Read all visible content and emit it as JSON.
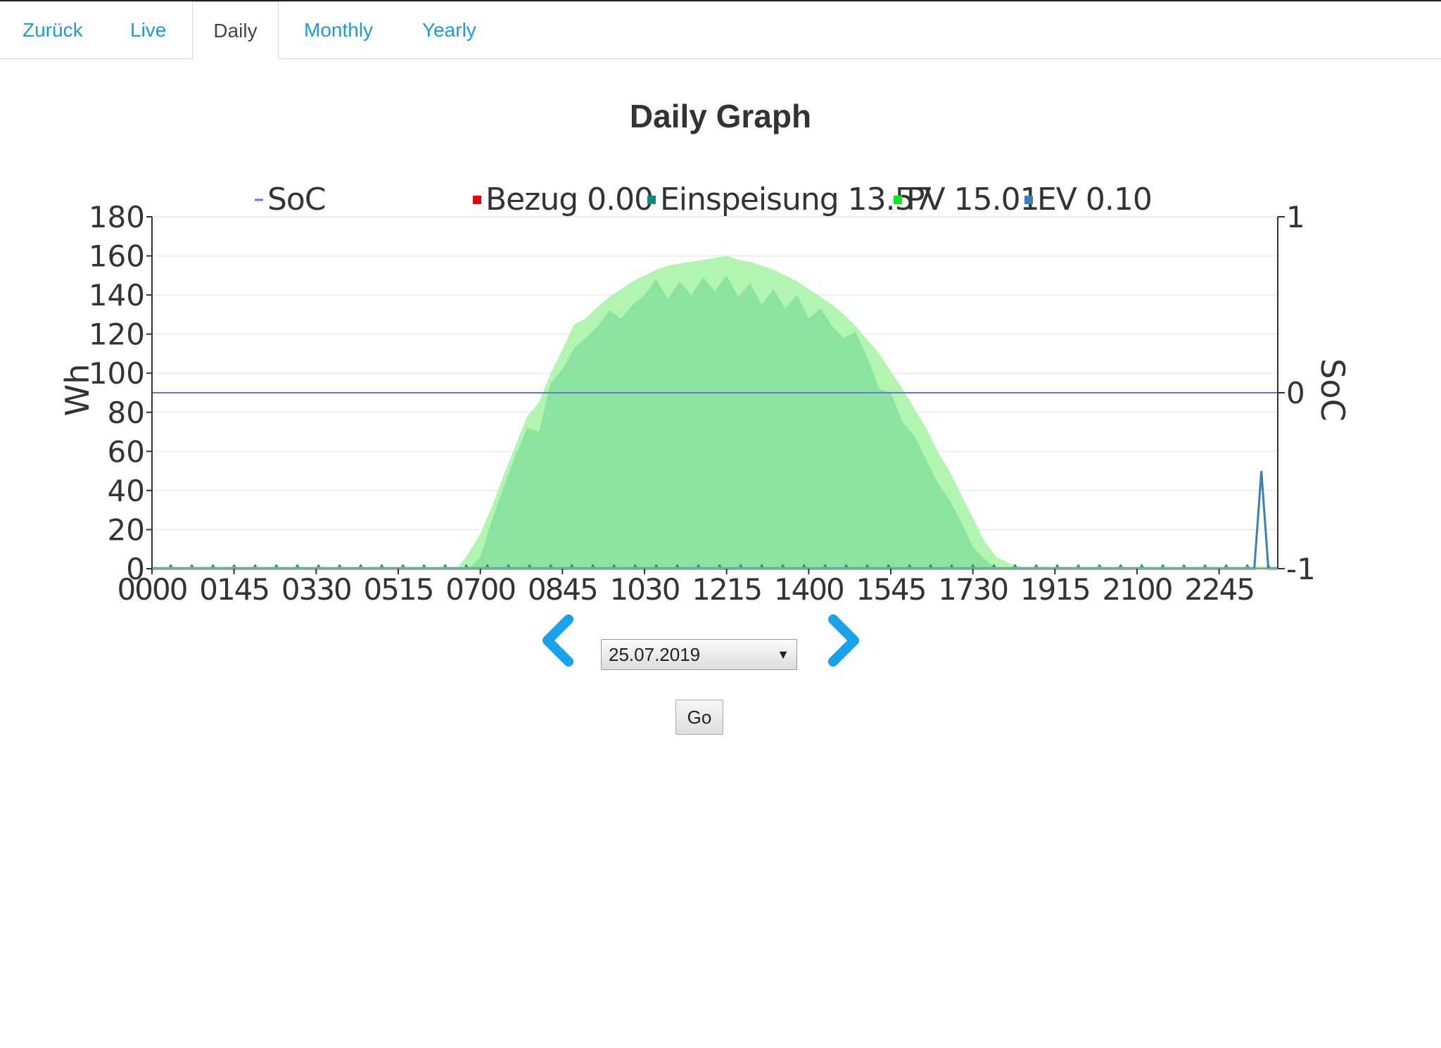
{
  "tabs": [
    {
      "label": "Zurück",
      "active": false
    },
    {
      "label": "Live",
      "active": false
    },
    {
      "label": "Daily",
      "active": true
    },
    {
      "label": "Monthly",
      "active": false
    },
    {
      "label": "Yearly",
      "active": false
    }
  ],
  "page_title": "Daily Graph",
  "date_select": {
    "value": "25.07.2019"
  },
  "go_button": {
    "label": "Go"
  },
  "colors": {
    "link": "#1f9ad6",
    "pv_fill": "#b2f5b0",
    "einspeisung_fill": "#8be3a0",
    "soc_line": "#6f72e6",
    "ev_line": "#3c7fb4",
    "bezug": "#e8000b",
    "einspeisung_marker": "#108a7e",
    "pv_marker": "#11e81a",
    "ev_marker": "#3b7db9",
    "arrow": "#1aa1ec"
  },
  "icons": {
    "prev": "chevron-left-icon",
    "next": "chevron-right-icon",
    "select_caret": "triangle-down-icon"
  },
  "chart_data": {
    "type": "area",
    "xlabel": "",
    "ylabel": "Wh",
    "y2label": "SoC",
    "ylim": [
      0,
      180
    ],
    "y2lim": [
      -1,
      1
    ],
    "yticks": [
      "0",
      "20",
      "40",
      "60",
      "80",
      "100",
      "120",
      "140",
      "160",
      "180"
    ],
    "y2ticks": [
      "-1",
      "0",
      "1"
    ],
    "xticks": [
      "0000",
      "0145",
      "0330",
      "0515",
      "0700",
      "0845",
      "1030",
      "1215",
      "1400",
      "1545",
      "1730",
      "1915",
      "2100",
      "2245"
    ],
    "xrange_hours": [
      0,
      24
    ],
    "grid": true,
    "legend_position": "top",
    "legend": [
      {
        "name": "SoC",
        "value": "",
        "marker": "line"
      },
      {
        "name": "Bezug",
        "value": "0.00",
        "marker": "square"
      },
      {
        "name": "Einspeisung",
        "value": "13.57",
        "marker": "square"
      },
      {
        "name": "PV",
        "value": "15.01",
        "marker": "square"
      },
      {
        "name": "EV",
        "value": "0.10",
        "marker": "square"
      }
    ],
    "series": [
      {
        "name": "PV",
        "axis": "left",
        "x_hours": [
          0,
          6.5,
          6.75,
          7.0,
          7.25,
          7.5,
          7.75,
          8.0,
          8.25,
          8.5,
          8.75,
          9.0,
          9.25,
          9.5,
          9.75,
          10.0,
          10.25,
          10.5,
          10.75,
          11.0,
          11.25,
          11.5,
          11.75,
          12.0,
          12.25,
          12.5,
          12.75,
          13.0,
          13.25,
          13.5,
          13.75,
          14.0,
          14.25,
          14.5,
          14.75,
          15.0,
          15.25,
          15.5,
          15.75,
          16.0,
          16.25,
          16.5,
          16.75,
          17.0,
          17.25,
          17.5,
          17.75,
          18.0,
          18.25,
          18.5,
          18.75,
          19.0,
          24
        ],
        "values": [
          0,
          0,
          8,
          18,
          32,
          48,
          63,
          78,
          85,
          100,
          112,
          125,
          128,
          134,
          139,
          143,
          147,
          150,
          153,
          155,
          156,
          157,
          158,
          159,
          160,
          158,
          157,
          155,
          153,
          150,
          147,
          143,
          139,
          135,
          130,
          124,
          117,
          110,
          101,
          92,
          82,
          72,
          60,
          50,
          38,
          26,
          14,
          6,
          3,
          1,
          0,
          0,
          0
        ]
      },
      {
        "name": "Einspeisung",
        "axis": "left",
        "x_hours": [
          0,
          6.5,
          6.75,
          7.0,
          7.25,
          7.5,
          7.75,
          8.0,
          8.25,
          8.5,
          8.75,
          9.0,
          9.25,
          9.5,
          9.75,
          10.0,
          10.25,
          10.5,
          10.75,
          11.0,
          11.25,
          11.5,
          11.75,
          12.0,
          12.25,
          12.5,
          12.75,
          13.0,
          13.25,
          13.5,
          13.75,
          14.0,
          14.25,
          14.5,
          14.75,
          15.0,
          15.25,
          15.5,
          15.75,
          16.0,
          16.25,
          16.5,
          16.75,
          17.0,
          17.25,
          17.5,
          17.75,
          18.0,
          18.25,
          18.5,
          24
        ],
        "values": [
          0,
          0,
          0,
          6,
          25,
          42,
          58,
          72,
          70,
          95,
          102,
          113,
          118,
          124,
          132,
          128,
          135,
          140,
          148,
          138,
          147,
          140,
          149,
          142,
          150,
          139,
          146,
          135,
          143,
          133,
          140,
          128,
          133,
          124,
          118,
          121,
          108,
          92,
          90,
          75,
          68,
          56,
          44,
          35,
          24,
          11,
          5,
          0,
          0,
          0,
          0
        ]
      },
      {
        "name": "EV",
        "axis": "left",
        "x_hours": [
          0,
          23.5,
          23.65,
          23.8,
          24
        ],
        "values": [
          0,
          0,
          50,
          0,
          0
        ]
      },
      {
        "name": "SoC",
        "axis": "right",
        "x_hours": [
          0,
          24
        ],
        "values": [
          0,
          0
        ]
      }
    ]
  }
}
